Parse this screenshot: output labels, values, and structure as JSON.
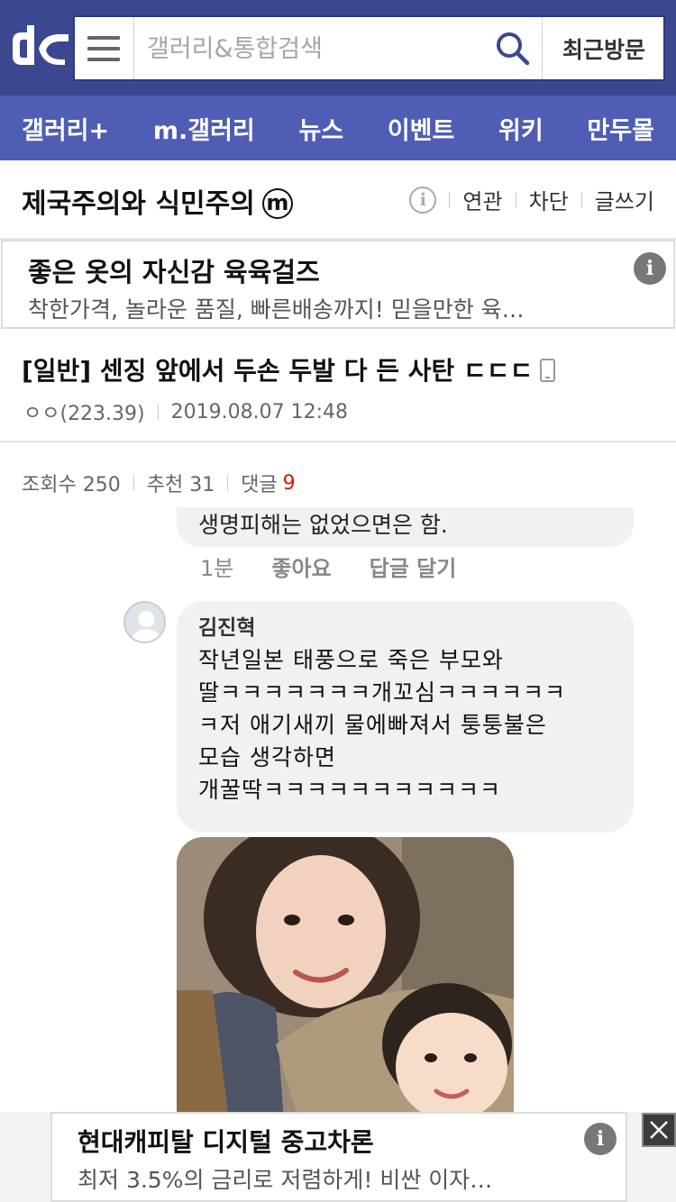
{
  "header": {
    "logo": "dc",
    "search_placeholder": "갤러리&통합검색",
    "recent_label": "최근방문",
    "brand_color": "#3b4890"
  },
  "nav": {
    "items": [
      {
        "label": "갤러리+"
      },
      {
        "label": "m.갤러리"
      },
      {
        "label": "뉴스"
      },
      {
        "label": "이벤트"
      },
      {
        "label": "위키"
      },
      {
        "label": "만두몰"
      }
    ],
    "color": "#4f5db4"
  },
  "gallery": {
    "title": "제국주의와 식민주의",
    "badge": "m",
    "info_icon": "info-outline-icon",
    "actions": [
      "연관",
      "차단",
      "글쓰기"
    ]
  },
  "ad_top": {
    "title": "좋은 옷의 자신감 육육걸즈",
    "desc": "착한가격, 놀라운 품질, 빠른배송까지! 믿을만한 육…",
    "info": "i"
  },
  "post": {
    "title": "[일반] 센징 앞에서 두손 두발 다 든 사탄 ㄷㄷㄷ",
    "author": "ㅇㅇ(223.39)",
    "date": "2019.08.07 12:48",
    "stats": {
      "views": "조회수 250",
      "recommend": "추천 31",
      "comments_label": "댓글",
      "comments_count": "9"
    }
  },
  "embedded": {
    "prev_comment_tail": "생명피해는 없었으면은 함.",
    "actions": {
      "time": "1분",
      "like": "좋아요",
      "reply": "답글 달기"
    },
    "comment": {
      "author": "김진혁",
      "lines": [
        "작년일본 태풍으로 죽은 부모와",
        "딸ㅋㅋㅋㅋㅋㅋㅋ개꼬심ㅋㅋㅋㅋㅋㅋ",
        "ㅋ저 애기새끼 물에빠져서 퉁퉁불은",
        "모습 생각하면",
        "개꿀딱ㅋㅋㅋㅋㅋㅋㅋㅋㅋㅋㅋ"
      ]
    }
  },
  "bottom_ad": {
    "title": "현대캐피탈 디지털 중고차론",
    "desc": "최저 3.5%의 금리로 저렴하게! 비싼 이자…",
    "info": "i",
    "close_icon": "close-icon"
  }
}
